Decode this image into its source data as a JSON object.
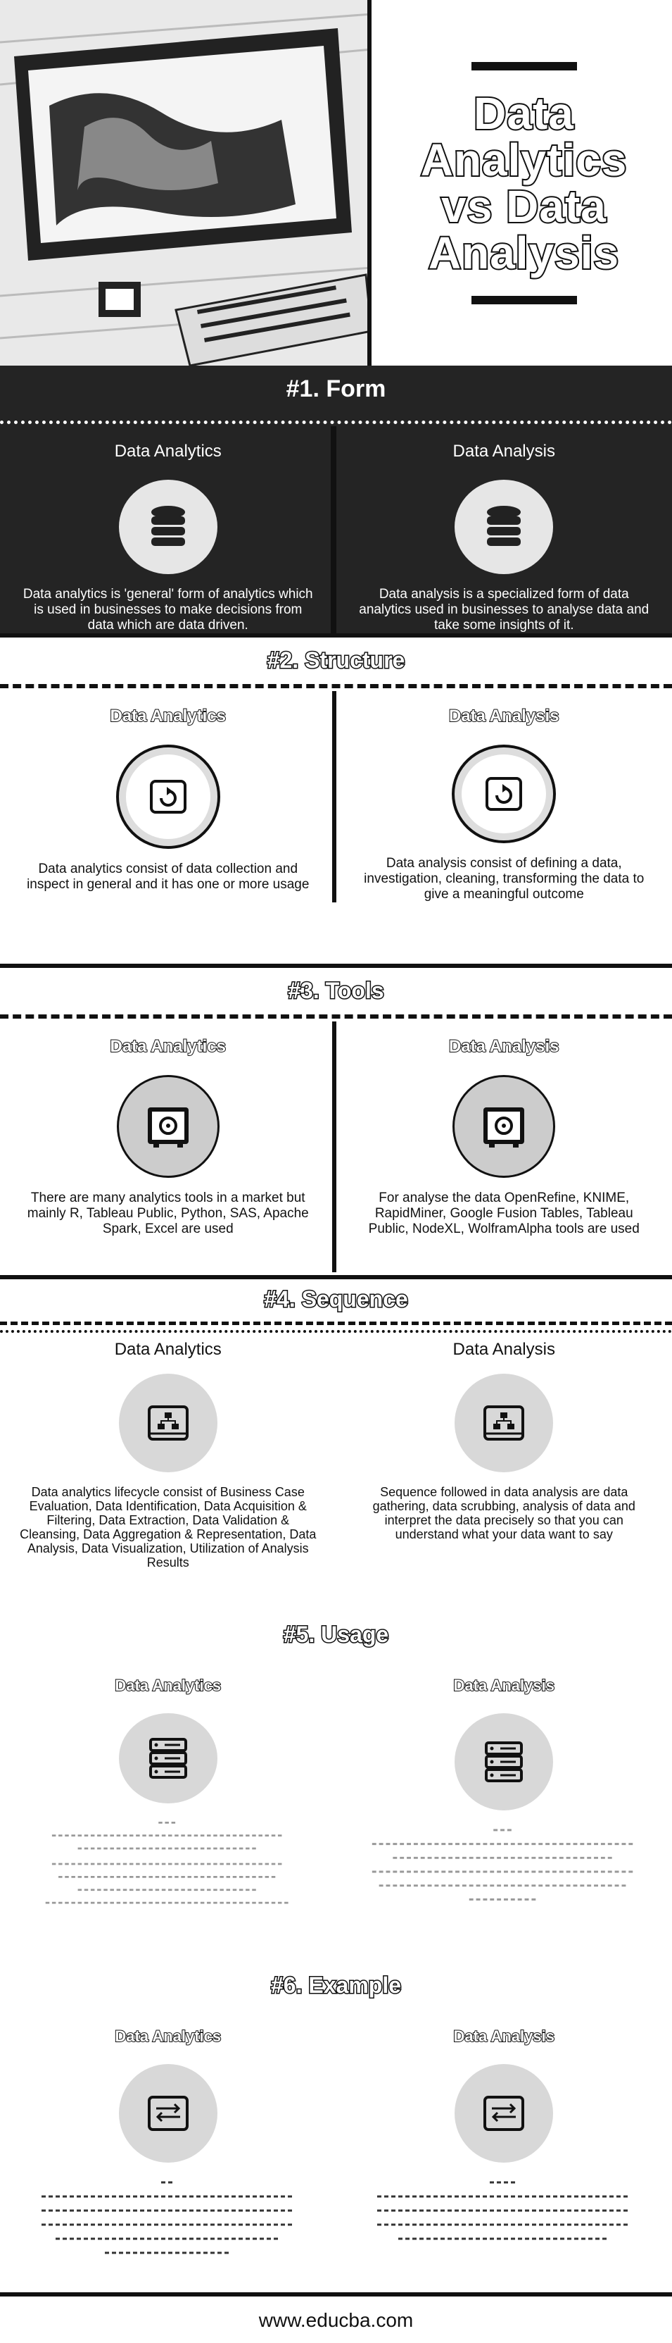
{
  "title": {
    "line1": "Data",
    "line2": "Analytics",
    "line3": "vs Data",
    "line4": "Analysis"
  },
  "col_left": "Data Analytics",
  "col_right": "Data Analysis",
  "sections": [
    {
      "title": "#1. Form",
      "left_text": "Data analytics is 'general' form of analytics which is used in businesses to make decisions from data which are data driven.",
      "right_text": "Data analysis is a specialized form of data analytics used in businesses to analyse data and take some insights of it."
    },
    {
      "title": "#2. Structure",
      "left_text": "Data analytics consist of data collection and inspect in general and it has one or more usage",
      "right_text": "Data analysis consist of defining a data, investigation, cleaning, transforming the data to give a meaningful outcome"
    },
    {
      "title": "#3. Tools",
      "left_text": "There are many analytics tools in a market but mainly R, Tableau Public, Python, SAS, Apache Spark, Excel are used",
      "right_text": "For analyse the data OpenRefine, KNIME, RapidMiner, Google Fusion Tables, Tableau Public, NodeXL, WolframAlpha tools are used"
    },
    {
      "title": "#4. Sequence",
      "left_text": "Data analytics lifecycle consist of Business Case Evaluation, Data Identification, Data Acquisition & Filtering, Data Extraction, Data Validation & Cleansing, Data Aggregation & Representation, Data Analysis, Data Visualization, Utilization of Analysis Results",
      "right_text": "Sequence followed in data analysis are data gathering, data scrubbing, analysis of data and interpret the data precisely so that you can understand what your data want to say"
    },
    {
      "title": "#5. Usage"
    },
    {
      "title": "#6. Example"
    }
  ],
  "footer": "www.educba.com"
}
